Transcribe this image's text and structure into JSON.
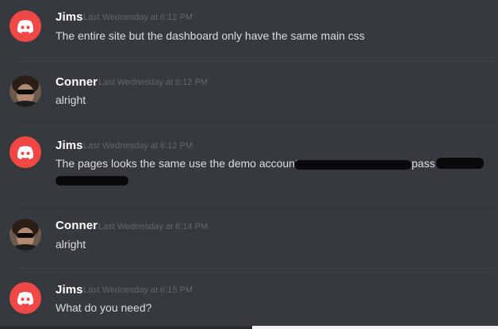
{
  "messages": [
    {
      "user": "Jims",
      "timestamp": "Last Wednesday at 6:12 PM",
      "text": "The entire site but the dashboard only have the same main css",
      "avatar_icon": "discord-logo-icon"
    },
    {
      "user": "Conner",
      "timestamp": "Last Wednesday at 6:12 PM",
      "text": "alright",
      "avatar_icon": "user-photo-avatar"
    },
    {
      "user": "Jims",
      "timestamp": "Last Wednesday at 6:12 PM",
      "text_before": "The pages looks the same use the demo account",
      "text_mid": "pass",
      "avatar_icon": "discord-logo-icon"
    },
    {
      "user": "Conner",
      "timestamp": "Last Wednesday at 6:14 PM",
      "text": "alright",
      "avatar_icon": "user-photo-avatar"
    },
    {
      "user": "Jims",
      "timestamp": "Last Wednesday at 6:15 PM",
      "text": "What do you need?",
      "avatar_icon": "discord-logo-icon"
    }
  ],
  "colors": {
    "background": "#36393e",
    "discord_red": "#f04747",
    "username": "#ffffff",
    "timestamp": "#63666b",
    "text": "#dcddde"
  }
}
